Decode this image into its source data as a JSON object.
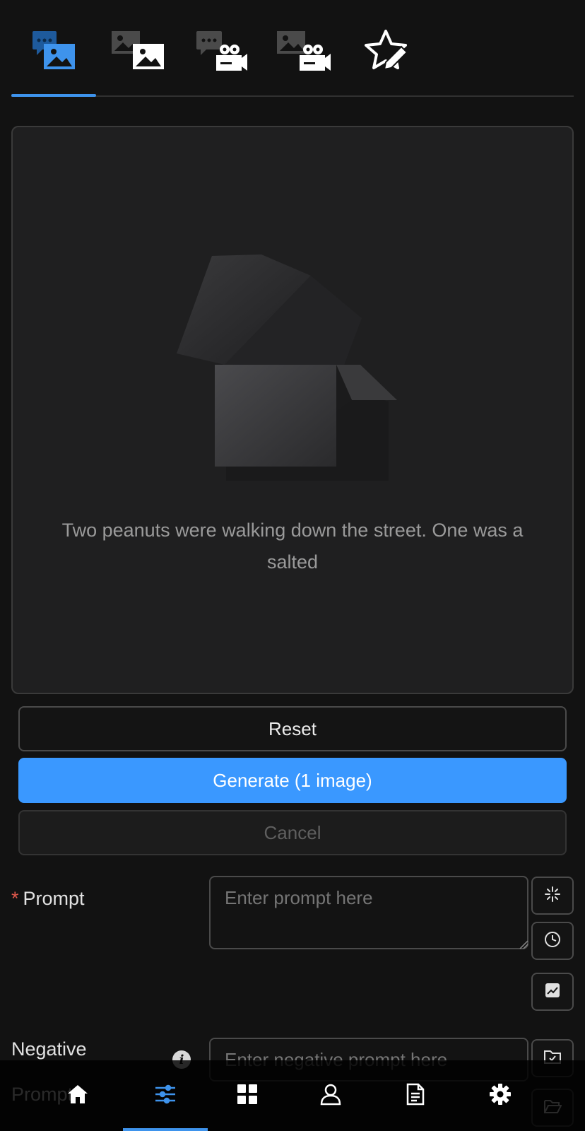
{
  "mode_tabs": [
    {
      "icon": "chat-image-icon",
      "active": true
    },
    {
      "icon": "image-to-image-icon",
      "active": false
    },
    {
      "icon": "chat-video-icon",
      "active": false
    },
    {
      "icon": "image-video-icon",
      "active": false
    },
    {
      "icon": "star-edit-icon",
      "active": false
    }
  ],
  "result": {
    "empty_message": "Two peanuts were walking down the street. One was a salted"
  },
  "actions": {
    "reset_label": "Reset",
    "generate_label": "Generate (1 image)",
    "cancel_label": "Cancel"
  },
  "form": {
    "prompt": {
      "required_mark": "*",
      "label": "Prompt",
      "placeholder": "Enter prompt here",
      "value": ""
    },
    "negative_prompt": {
      "label": "Negative Prompt",
      "placeholder": "Enter negative prompt here",
      "value": ""
    }
  },
  "bottom_nav": [
    {
      "icon": "home-icon",
      "active": false
    },
    {
      "icon": "sliders-icon",
      "active": true
    },
    {
      "icon": "grid-icon",
      "active": false
    },
    {
      "icon": "user-icon",
      "active": false
    },
    {
      "icon": "document-icon",
      "active": false
    },
    {
      "icon": "gear-icon",
      "active": false
    }
  ],
  "colors": {
    "accent": "#3a98ff",
    "background": "#121212",
    "panel": "#1f1f20",
    "required": "#e0584c"
  }
}
